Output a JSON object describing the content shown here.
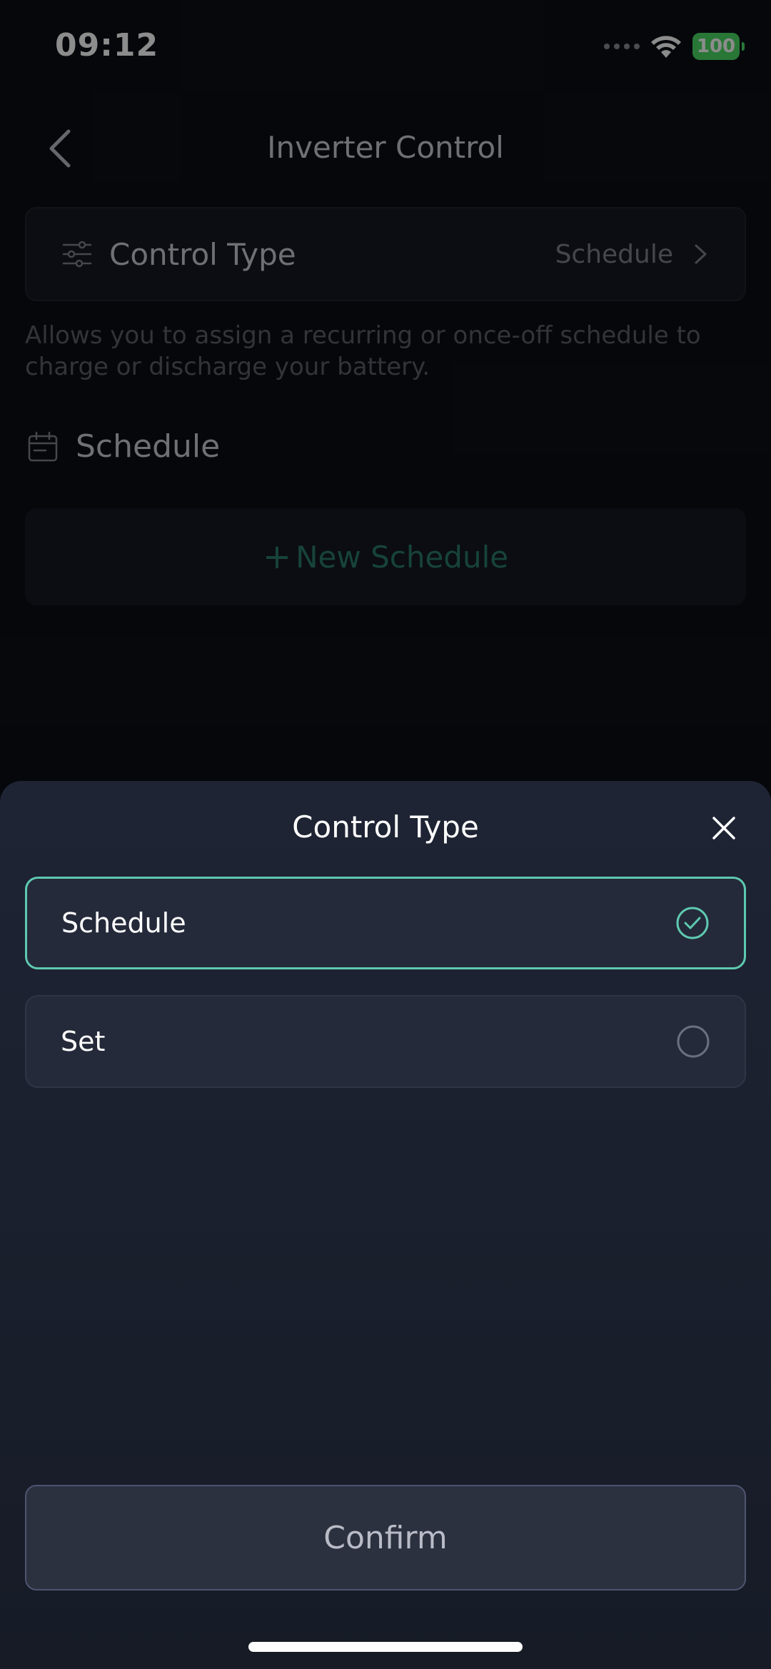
{
  "status_bar": {
    "time": "09:12",
    "battery": "100",
    "battery_color": "#4cd964"
  },
  "header": {
    "title": "Inverter Control",
    "back_icon": "chevron-left-icon"
  },
  "control_type_card": {
    "label": "Control Type",
    "value": "Schedule",
    "icon": "sliders-icon"
  },
  "description": "Allows you to assign a recurring or once-off schedule to charge or discharge your battery.",
  "schedule_section": {
    "heading": "Schedule",
    "icon": "calendar-icon",
    "new_schedule_plus": "+",
    "new_schedule_label": "New Schedule"
  },
  "sheet": {
    "title": "Control Type",
    "options": [
      {
        "label": "Schedule",
        "selected": true
      },
      {
        "label": "Set",
        "selected": false
      }
    ],
    "confirm_label": "Confirm",
    "accent_color": "#5ec9b0"
  }
}
